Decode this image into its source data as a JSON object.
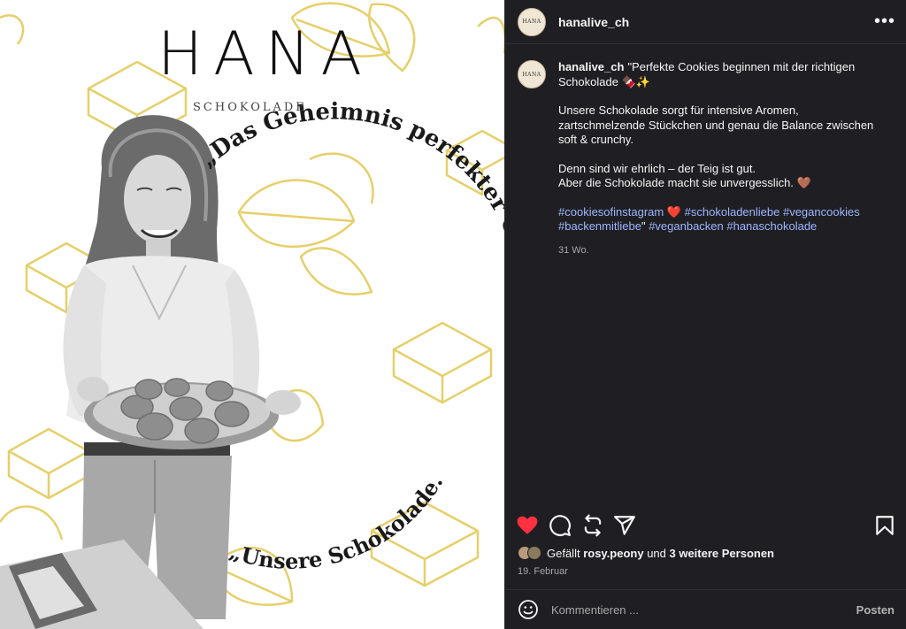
{
  "image": {
    "brand_name": "HANA",
    "brand_subtitle": "SCHOKOLADE",
    "quote_main": "„Das Geheimnis perfekter Cookies?",
    "quote_answer": "„Unsere Schokolade.",
    "pattern_color": "#e6cf6a"
  },
  "header": {
    "avatar_text": "HANA",
    "username": "hanalive_ch",
    "more_icon": "more-horizontal-icon"
  },
  "caption": {
    "username": "hanalive_ch",
    "line1": "\"Perfekte Cookies beginnen mit der richtigen Schokolade 🍫✨",
    "para2": "Unsere Schokolade sorgt für intensive Aromen, zartschmelzende Stückchen und genau die Balance zwischen soft & crunchy.",
    "para3a": "Denn sind wir ehrlich – der Teig ist gut.",
    "para3b": "Aber die Schokolade macht sie unvergesslich. 🤎",
    "hashtags_line1_a": "#cookiesofinstagram",
    "hashtags_line1_heart": " ❤️ ",
    "hashtags_line1_b": "#schokoladenliebe #vegancookies",
    "hashtags_line2_a": "#backenmitliebe",
    "hashtags_line2_quote": "\" ",
    "hashtags_line2_b": "#veganbacken #hanaschokolade",
    "time_ago": "31 Wo."
  },
  "actions": {
    "like_color": "#ff3040",
    "icons": [
      "heart-icon",
      "comment-icon",
      "repost-icon",
      "share-icon",
      "bookmark-icon"
    ]
  },
  "likes": {
    "prefix": "Gefällt ",
    "user": "rosy.peony",
    "middle": " und ",
    "others": "3 weitere Personen"
  },
  "date": "19. Februar",
  "comment": {
    "placeholder": "Kommentieren ...",
    "post_label": "Posten"
  }
}
